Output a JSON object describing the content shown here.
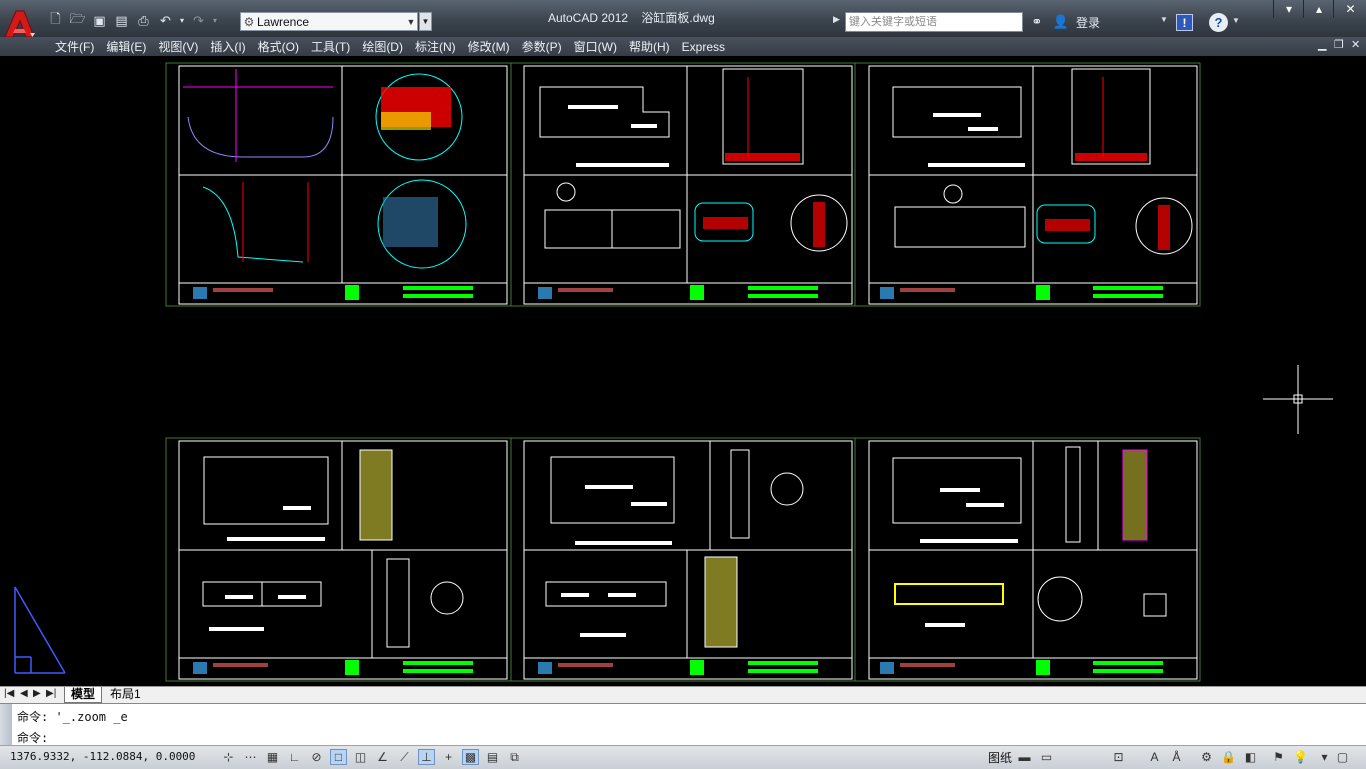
{
  "app": {
    "title": "AutoCAD 2012",
    "file": "浴缸面板.dwg"
  },
  "qat": {
    "icons": [
      "new-icon",
      "open-icon",
      "save-icon",
      "saveas-icon",
      "plot-icon",
      "undo-icon",
      "redo-icon"
    ],
    "workspace": "Lawrence"
  },
  "infocenter": {
    "search_placeholder": "键入关键字或短语",
    "login_label": "登录"
  },
  "menu": {
    "items": [
      "文件(F)",
      "编辑(E)",
      "视图(V)",
      "插入(I)",
      "格式(O)",
      "工具(T)",
      "绘图(D)",
      "标注(N)",
      "修改(M)",
      "参数(P)",
      "窗口(W)",
      "帮助(H)",
      "Express"
    ]
  },
  "tabs": {
    "model": "模型",
    "layout": "布局1"
  },
  "command": {
    "history": "命令: '_.zoom _e",
    "prompt": "命令:"
  },
  "status": {
    "coords": "1376.9332, -112.0884, 0.0000",
    "paper": "图纸"
  },
  "colors": {
    "canvas": "#000000",
    "white_lines": "#ffffff",
    "magenta": "#ff00ff",
    "red": "#ff0000",
    "green": "#00ff00",
    "cyan": "#00ffff",
    "yellow": "#ffff00",
    "border_green": "#3e7a2e"
  }
}
